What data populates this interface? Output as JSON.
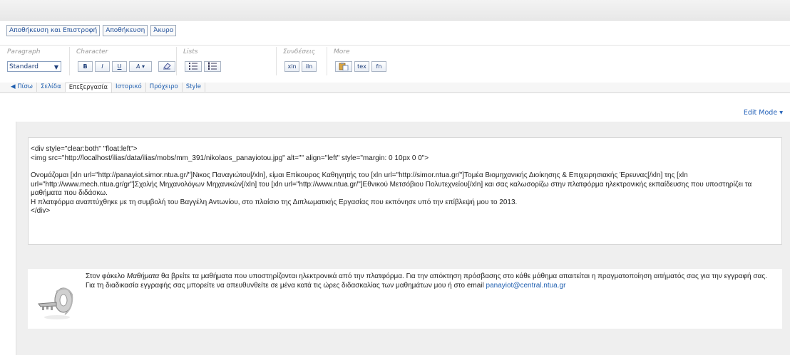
{
  "commands": {
    "save_return": "Αποθήκευση και Επιστροφή",
    "save": "Αποθήκευση",
    "cancel": "Άκυρο"
  },
  "toolbar": {
    "paragraph": {
      "label": "Paragraph",
      "value": "Standard"
    },
    "character": {
      "label": "Character",
      "bold": "B",
      "italic": "I",
      "underline": "U",
      "color": "A"
    },
    "lists": {
      "label": "Lists"
    },
    "links": {
      "label": "Συνδέσεις",
      "xln": "xln",
      "iln": "iln"
    },
    "more": {
      "label": "More",
      "tex": "tex",
      "fn": "fn"
    }
  },
  "tabs": [
    {
      "label": "◀ Πίσω"
    },
    {
      "label": "Σελίδα"
    },
    {
      "label": "Επεξεργασία"
    },
    {
      "label": "Ιστορικό"
    },
    {
      "label": "Πρόχειρο"
    },
    {
      "label": "Style"
    }
  ],
  "edit_mode": "Edit Mode",
  "text_block": {
    "line1": "<div style=\"clear:both\" \"float:left\">",
    "line2": "<img src=\"http://localhost/ilias/data/ilias/mobs/mm_391/nikolaos_panayiotou.jpg\" alt=\"\" align=\"left\" style=\"margin: 0 10px 0 0\">",
    "para": "Ονομάζομαι [xln url=\"http://panayiot.simor.ntua.gr/\"]Νικος Παναγιώτου[/xln], είμαι Επίκουρος Καθηγητής του [xln url=\"http://simor.ntua.gr/\"]Τομέα Βιομηχανικής Διοίκησης & Επιχειρησιακής Έρευνας[/xln] της [xln url=\"http://www.mech.ntua.gr/gr\"]Σχολής Μηχανολόγων Μηχανικών[/xln] του [xln url=\"http://www.ntua.gr/\"]Εθνικού Μετσόβιου Πολυτεχνείου[/xln] και σας καλωσορίζω στην πλατφόρμα ηλεκτρονικής εκπαίδευσης που υποστηρίζει τα μαθήματα που διδάσκω.",
    "line4": "Η πλατφόρμα αναπτύχθηκε με τη συμβολή του Βαγγέλη Αντωνίου, στο πλαίσιο της Διπλωματικής Εργασίας που εκπόνησε υπό την επίβλεψή μου το 2013.",
    "line5": "</div>"
  },
  "info_block": {
    "text_before": "Στον φάκελο ",
    "folder": "Μαθήματα",
    "text_after": " θα βρείτε τα μαθήματα που υποστηρίζονται ηλεκτρονικά από την πλατφόρμα. Για την απόκτηση πρόσβασης στο κάθε μάθημα απαιτείται η πραγματοποίηση αιτήματός σας για την εγγραφή σας. Για τη διαδικασία εγγραφής σας μπορείτε να απευθυνθείτε σε μένα κατά τις ώρες διδασκαλίας των μαθημάτων μου ή στο email ",
    "email": "panayiot@central.ntua.gr"
  }
}
